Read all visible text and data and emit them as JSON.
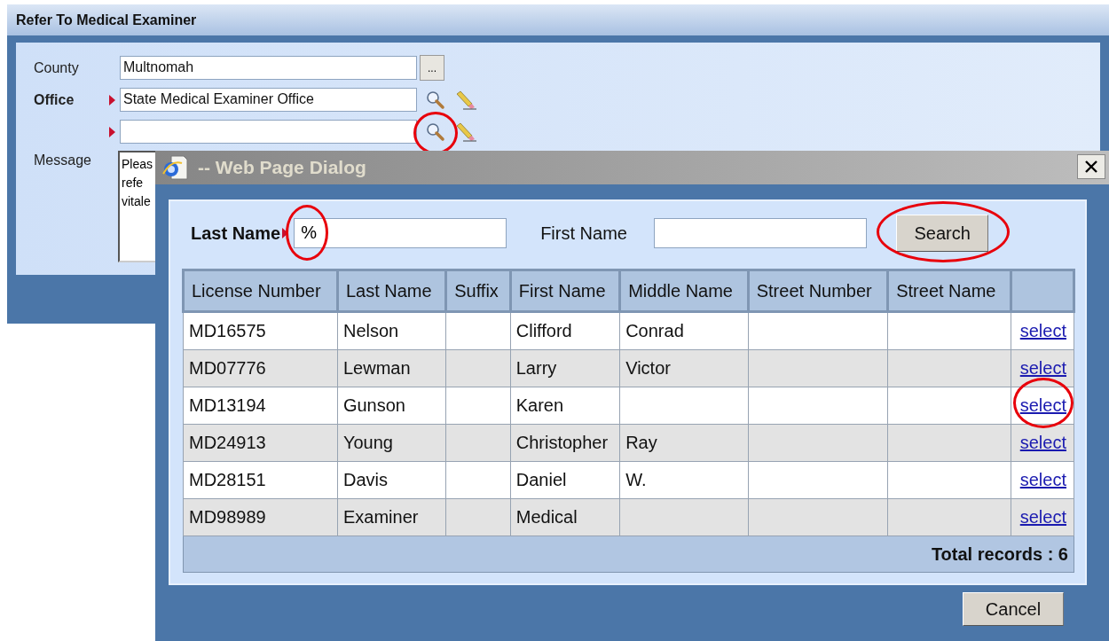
{
  "window": {
    "title": "Refer To Medical Examiner"
  },
  "form": {
    "county": {
      "label": "County",
      "value": "Multnomah",
      "button": "..."
    },
    "office": {
      "label": "Office",
      "required": true,
      "value": "State Medical Examiner Office"
    },
    "examiner": {
      "required": true,
      "circled": true
    },
    "message": {
      "label": "Message",
      "lines": [
        "Pleas",
        "refe",
        "vitale"
      ]
    }
  },
  "dialog": {
    "title": "-- Web Page Dialog",
    "last_name": {
      "label": "Last Name",
      "required": true,
      "value": "%",
      "circled": true
    },
    "first_name": {
      "label": "First Name"
    },
    "search_button": {
      "label": "Search",
      "circled": true
    },
    "columns": [
      "License Number",
      "Last Name",
      "Suffix",
      "First Name",
      "Middle Name",
      "Street Number",
      "Street Name"
    ],
    "rows": [
      {
        "cells": [
          "MD16575",
          "Nelson",
          "",
          "Clifford",
          "Conrad",
          "",
          ""
        ],
        "link": "select",
        "circled": false
      },
      {
        "cells": [
          "MD07776",
          "Lewman",
          "",
          "Larry",
          "Victor",
          "",
          ""
        ],
        "link": "select",
        "circled": false
      },
      {
        "cells": [
          "MD13194",
          "Gunson",
          "",
          "Karen",
          "",
          "",
          ""
        ],
        "link": "select",
        "circled": true
      },
      {
        "cells": [
          "MD24913",
          "Young",
          "",
          "Christopher",
          "Ray",
          "",
          ""
        ],
        "link": "select",
        "circled": false
      },
      {
        "cells": [
          "MD28151",
          "Davis",
          "",
          "Daniel",
          "W.",
          "",
          ""
        ],
        "link": "select",
        "circled": false
      },
      {
        "cells": [
          "MD98989",
          "Examiner",
          "",
          "Medical",
          "",
          "",
          ""
        ],
        "link": "select",
        "circled": false
      }
    ],
    "total": "Total records : 6",
    "cancel": "Cancel"
  }
}
